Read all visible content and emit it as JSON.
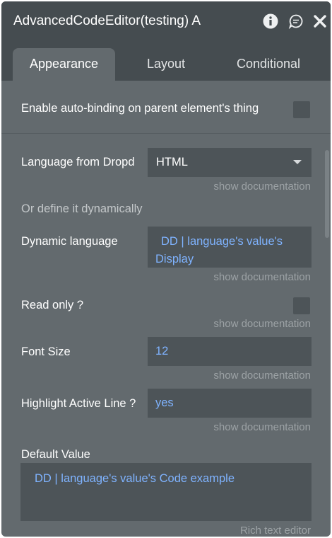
{
  "window": {
    "title": "AdvancedCodeEditor(testing) A",
    "icons": [
      "info-icon",
      "comment-icon",
      "close-icon"
    ]
  },
  "tabs": [
    {
      "label": "Appearance",
      "active": true
    },
    {
      "label": "Layout",
      "active": false
    },
    {
      "label": "Conditional",
      "active": false
    }
  ],
  "autobinding": {
    "label": "Enable auto-binding on parent element's thing",
    "checked": false
  },
  "language": {
    "label": "Language from Dropd",
    "value": "HTML",
    "doc": "show documentation"
  },
  "or_dynamic": "Or define it dynamically",
  "dynamic_language": {
    "label": "Dynamic language",
    "value": "DD | language's value's Display",
    "doc": "show documentation"
  },
  "read_only": {
    "label": "Read only ?",
    "checked": false,
    "doc": "show documentation"
  },
  "font_size": {
    "label": "Font Size",
    "value": "12",
    "doc": "show documentation"
  },
  "highlight": {
    "label": "Highlight Active Line ?",
    "value": "yes",
    "doc": "show documentation"
  },
  "default_value": {
    "label": "Default Value",
    "value": "DD | language's value's Code example",
    "hint": "Rich text editor"
  },
  "colors": {
    "panel": "#636a6e",
    "header": "#454c50",
    "field": "#4d5458",
    "dynamic_text": "#7fb3ff"
  }
}
